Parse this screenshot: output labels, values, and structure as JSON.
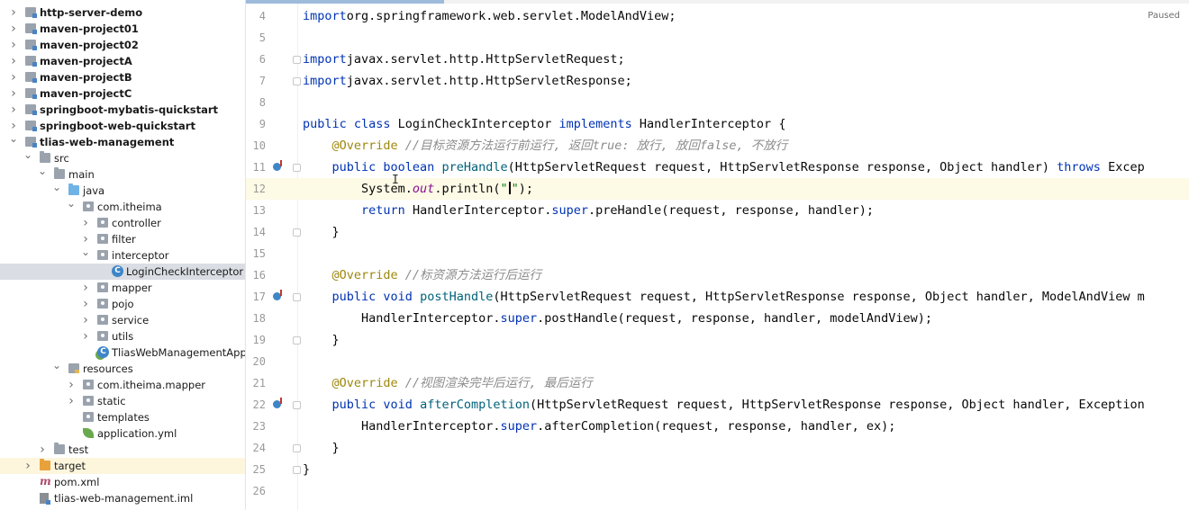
{
  "project_tree": {
    "items": [
      {
        "label": "http-server-demo",
        "depth": 0,
        "arrow": "collapsed",
        "icon": "module-folder-icon",
        "bold": true
      },
      {
        "label": "maven-project01",
        "depth": 0,
        "arrow": "collapsed",
        "icon": "module-folder-icon",
        "bold": true
      },
      {
        "label": "maven-project02",
        "depth": 0,
        "arrow": "collapsed",
        "icon": "module-folder-icon",
        "bold": true
      },
      {
        "label": "maven-projectA",
        "depth": 0,
        "arrow": "collapsed",
        "icon": "module-folder-icon",
        "bold": true
      },
      {
        "label": "maven-projectB",
        "depth": 0,
        "arrow": "collapsed",
        "icon": "module-folder-icon",
        "bold": true
      },
      {
        "label": "maven-projectC",
        "depth": 0,
        "arrow": "collapsed",
        "icon": "module-folder-icon",
        "bold": true
      },
      {
        "label": "springboot-mybatis-quickstart",
        "depth": 0,
        "arrow": "collapsed",
        "icon": "module-folder-icon",
        "bold": true
      },
      {
        "label": "springboot-web-quickstart",
        "depth": 0,
        "arrow": "collapsed",
        "icon": "module-folder-icon",
        "bold": true
      },
      {
        "label": "tlias-web-management",
        "depth": 0,
        "arrow": "expanded",
        "icon": "module-folder-icon",
        "bold": true
      },
      {
        "label": "src",
        "depth": 1,
        "arrow": "expanded",
        "icon": "folder-icon"
      },
      {
        "label": "main",
        "depth": 2,
        "arrow": "expanded",
        "icon": "folder-icon"
      },
      {
        "label": "java",
        "depth": 3,
        "arrow": "expanded",
        "icon": "source-folder-icon"
      },
      {
        "label": "com.itheima",
        "depth": 4,
        "arrow": "expanded",
        "icon": "package-icon"
      },
      {
        "label": "controller",
        "depth": 5,
        "arrow": "collapsed",
        "icon": "package-icon"
      },
      {
        "label": "filter",
        "depth": 5,
        "arrow": "collapsed",
        "icon": "package-icon"
      },
      {
        "label": "interceptor",
        "depth": 5,
        "arrow": "expanded",
        "icon": "package-icon"
      },
      {
        "label": "LoginCheckInterceptor",
        "depth": 6,
        "arrow": "none",
        "icon": "class-icon",
        "selected": true
      },
      {
        "label": "mapper",
        "depth": 5,
        "arrow": "collapsed",
        "icon": "package-icon"
      },
      {
        "label": "pojo",
        "depth": 5,
        "arrow": "collapsed",
        "icon": "package-icon"
      },
      {
        "label": "service",
        "depth": 5,
        "arrow": "collapsed",
        "icon": "package-icon"
      },
      {
        "label": "utils",
        "depth": 5,
        "arrow": "collapsed",
        "icon": "package-icon"
      },
      {
        "label": "TliasWebManagementApplic",
        "depth": 5,
        "arrow": "none",
        "icon": "spring-class-icon"
      },
      {
        "label": "resources",
        "depth": 3,
        "arrow": "expanded",
        "icon": "resources-folder-icon"
      },
      {
        "label": "com.itheima.mapper",
        "depth": 4,
        "arrow": "collapsed",
        "icon": "package-icon"
      },
      {
        "label": "static",
        "depth": 4,
        "arrow": "collapsed",
        "icon": "package-icon"
      },
      {
        "label": "templates",
        "depth": 4,
        "arrow": "none",
        "icon": "package-icon"
      },
      {
        "label": "application.yml",
        "depth": 4,
        "arrow": "none",
        "icon": "yml-leaf-icon"
      },
      {
        "label": "test",
        "depth": 2,
        "arrow": "collapsed",
        "icon": "folder-icon"
      },
      {
        "label": "target",
        "depth": 1,
        "arrow": "collapsed",
        "icon": "excluded-folder-icon",
        "excluded": true
      },
      {
        "label": "pom.xml",
        "depth": 1,
        "arrow": "none",
        "icon": "maven-icon"
      },
      {
        "label": "tlias-web-management.iml",
        "depth": 1,
        "arrow": "none",
        "icon": "iml-file-icon"
      }
    ]
  },
  "editor": {
    "status_text": "Paused",
    "lines": [
      {
        "num": "4",
        "tokens": [
          [
            "kw",
            "import"
          ],
          [
            "",
            "org.springframework.web.servlet.ModelAndView;"
          ]
        ]
      },
      {
        "num": "5",
        "tokens": []
      },
      {
        "num": "6",
        "tokens": [
          [
            "kw",
            "import"
          ],
          [
            "",
            "javax.servlet.http.HttpServletRequest;"
          ]
        ],
        "fold": true
      },
      {
        "num": "7",
        "tokens": [
          [
            "kw",
            "import"
          ],
          [
            "",
            "javax.servlet.http.HttpServletResponse;"
          ]
        ],
        "fold": true
      },
      {
        "num": "8",
        "tokens": []
      },
      {
        "num": "9",
        "tokens": [
          [
            "kw",
            "public class "
          ],
          [
            "",
            "LoginCheckInterceptor "
          ],
          [
            "kw",
            "implements "
          ],
          [
            "",
            "HandlerInterceptor {"
          ]
        ]
      },
      {
        "num": "10",
        "tokens": [
          [
            "",
            "    "
          ],
          [
            "ann",
            "@Override "
          ],
          [
            "cmt",
            "//目标资源方法运行前运行, 返回true: 放行, 放回false, 不放行"
          ]
        ]
      },
      {
        "num": "11",
        "tokens": [
          [
            "",
            "    "
          ],
          [
            "kw",
            "public boolean "
          ],
          [
            "fn",
            "preHandle"
          ],
          [
            "",
            "(HttpServletRequest request, HttpServletResponse response, Object handler) "
          ],
          [
            "kw",
            "throws "
          ],
          [
            "",
            "Excep"
          ]
        ],
        "gutter_icon": true,
        "fold": true
      },
      {
        "num": "12",
        "tokens": [
          [
            "",
            "        System."
          ],
          [
            "stat",
            "out"
          ],
          [
            "",
            ".println("
          ],
          [
            "str",
            "\""
          ],
          [
            "caret",
            ""
          ],
          [
            "str",
            "\""
          ],
          [
            "",
            ");"
          ]
        ],
        "caret_line": true
      },
      {
        "num": "13",
        "tokens": [
          [
            "",
            "        "
          ],
          [
            "kw",
            "return "
          ],
          [
            "",
            "HandlerInterceptor."
          ],
          [
            "kw",
            "super"
          ],
          [
            "",
            ".preHandle(request, response, handler);"
          ]
        ]
      },
      {
        "num": "14",
        "tokens": [
          [
            "",
            "    }"
          ]
        ],
        "fold": true
      },
      {
        "num": "15",
        "tokens": []
      },
      {
        "num": "16",
        "tokens": [
          [
            "",
            "    "
          ],
          [
            "ann",
            "@Override "
          ],
          [
            "cmt",
            "//标资源方法运行后运行"
          ]
        ]
      },
      {
        "num": "17",
        "tokens": [
          [
            "",
            "    "
          ],
          [
            "kw",
            "public void "
          ],
          [
            "fn",
            "postHandle"
          ],
          [
            "",
            "(HttpServletRequest request, HttpServletResponse response, Object handler, ModelAndView m"
          ]
        ],
        "gutter_icon": true,
        "fold": true
      },
      {
        "num": "18",
        "tokens": [
          [
            "",
            "        HandlerInterceptor."
          ],
          [
            "kw",
            "super"
          ],
          [
            "",
            ".postHandle(request, response, handler, modelAndView);"
          ]
        ]
      },
      {
        "num": "19",
        "tokens": [
          [
            "",
            "    }"
          ]
        ],
        "fold": true
      },
      {
        "num": "20",
        "tokens": []
      },
      {
        "num": "21",
        "tokens": [
          [
            "",
            "    "
          ],
          [
            "ann",
            "@Override "
          ],
          [
            "cmt",
            "//视图渲染完毕后运行, 最后运行"
          ]
        ]
      },
      {
        "num": "22",
        "tokens": [
          [
            "",
            "    "
          ],
          [
            "kw",
            "public void "
          ],
          [
            "fn",
            "afterCompletion"
          ],
          [
            "",
            "(HttpServletRequest request, HttpServletResponse response, Object handler, Exception"
          ]
        ],
        "gutter_icon": true,
        "fold": true
      },
      {
        "num": "23",
        "tokens": [
          [
            "",
            "        HandlerInterceptor."
          ],
          [
            "kw",
            "super"
          ],
          [
            "",
            ".afterCompletion(request, response, handler, ex);"
          ]
        ]
      },
      {
        "num": "24",
        "tokens": [
          [
            "",
            "    }"
          ]
        ],
        "fold": true
      },
      {
        "num": "25",
        "tokens": [
          [
            "",
            "}"
          ]
        ],
        "fold": true
      },
      {
        "num": "26",
        "tokens": []
      }
    ]
  }
}
